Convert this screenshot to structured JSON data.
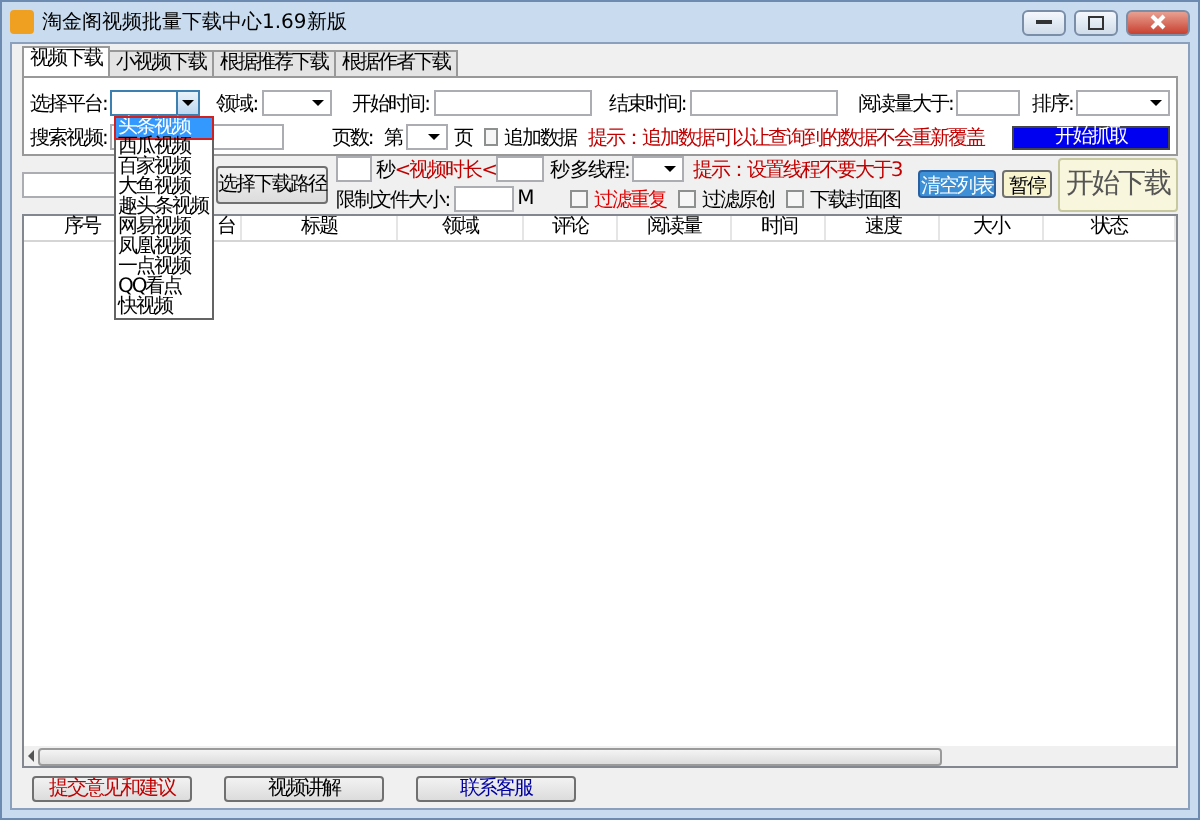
{
  "window": {
    "title": "淘金阁视频批量下载中心1.69新版"
  },
  "tabs": [
    {
      "label": "视频下载",
      "selected": true
    },
    {
      "label": "小视频下载",
      "selected": false
    },
    {
      "label": "根据推荐下载",
      "selected": false
    },
    {
      "label": "根据作者下载",
      "selected": false
    }
  ],
  "filters": {
    "platform_label": "选择平台:",
    "field_label": "领域:",
    "start_label": "开始时间:",
    "end_label": "结束时间:",
    "reads_label": "阅读量大于:",
    "sort_label": "排序:",
    "search_label": "搜索视频:",
    "pages_label": "页数:",
    "page_prefix": "第",
    "page_suffix": "页",
    "append": {
      "label": "追加数据",
      "checked": false
    },
    "append_tip": "提示：追加数据可以让查询到的数据不会重新覆盖",
    "fetch_button": "开始抓取"
  },
  "download": {
    "path_button": "选择下载路径",
    "min_unit": "秒",
    "duration_label": "<视频时长<",
    "max_unit": "秒",
    "size_label": "限制文件大小:",
    "size_unit": "M",
    "threads_label": "多线程:",
    "threads_tip": "提示：设置线程不要大于3",
    "options": [
      {
        "label": "过滤重复",
        "checked": false,
        "kind": "warning"
      },
      {
        "label": "过滤原创",
        "checked": false,
        "kind": "normal"
      },
      {
        "label": "下载封面图",
        "checked": false,
        "kind": "normal"
      }
    ],
    "clear_button": "清空列表",
    "pause_button": "暂停",
    "start_button": "开始下载"
  },
  "table": {
    "columns": [
      "序号",
      "台",
      "标题",
      "领域",
      "评论",
      "阅读量",
      "时间",
      "速度",
      "大小",
      "状态"
    ]
  },
  "platform_dropdown": {
    "options": [
      {
        "label": "头条视频",
        "selected": true
      },
      {
        "label": "西瓜视频",
        "selected": false
      },
      {
        "label": "百家视频",
        "selected": false
      },
      {
        "label": "大鱼视频",
        "selected": false
      },
      {
        "label": "趣头条视频",
        "selected": false
      },
      {
        "label": "网易视频",
        "selected": false
      },
      {
        "label": "凤凰视频",
        "selected": false
      },
      {
        "label": "一点视频",
        "selected": false
      },
      {
        "label": "QQ看点",
        "selected": false
      },
      {
        "label": "快视频",
        "selected": false
      }
    ]
  },
  "footer_buttons": [
    {
      "label": "提交意见和建议",
      "kind": "feedback"
    },
    {
      "label": "视频讲解",
      "kind": "normal"
    },
    {
      "label": "联系客服",
      "kind": "contact"
    }
  ]
}
